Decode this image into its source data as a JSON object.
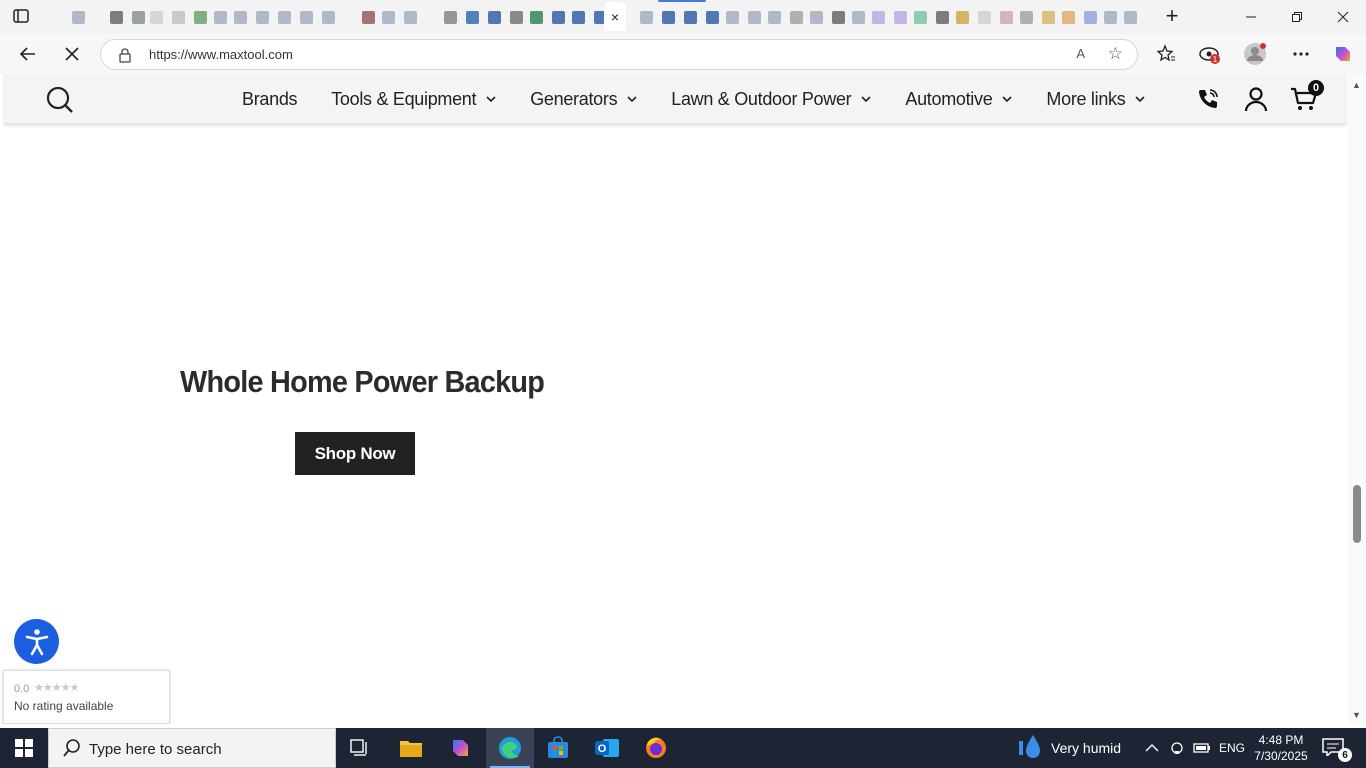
{
  "browser": {
    "url": "https://www.maxtool.com",
    "tab_count_icons": 48,
    "active_tab_close": "×",
    "new_tab": "+",
    "read_aloud": "A",
    "extensions_badge": "1"
  },
  "site": {
    "nav": {
      "items": [
        {
          "label": "Brands",
          "has_dropdown": false
        },
        {
          "label": "Tools & Equipment",
          "has_dropdown": true
        },
        {
          "label": "Generators",
          "has_dropdown": true
        },
        {
          "label": "Lawn & Outdoor Power",
          "has_dropdown": true
        },
        {
          "label": "Automotive",
          "has_dropdown": true
        },
        {
          "label": "More links",
          "has_dropdown": true
        }
      ],
      "cart_count": "0"
    },
    "hero": {
      "title": "Whole Home Power Backup",
      "cta": "Shop Now"
    },
    "rating_widget": {
      "score": "0.0",
      "stars": "★★★★★",
      "text": "No rating available"
    }
  },
  "taskbar": {
    "search_placeholder": "Type here to search",
    "weather": "Very humid",
    "language": "ENG",
    "time": "4:48 PM",
    "date": "7/30/2025",
    "notifications": "6"
  },
  "colors": {
    "accent": "#1b5fe0",
    "button_dark": "#222222",
    "taskbar": "#1d2535"
  }
}
